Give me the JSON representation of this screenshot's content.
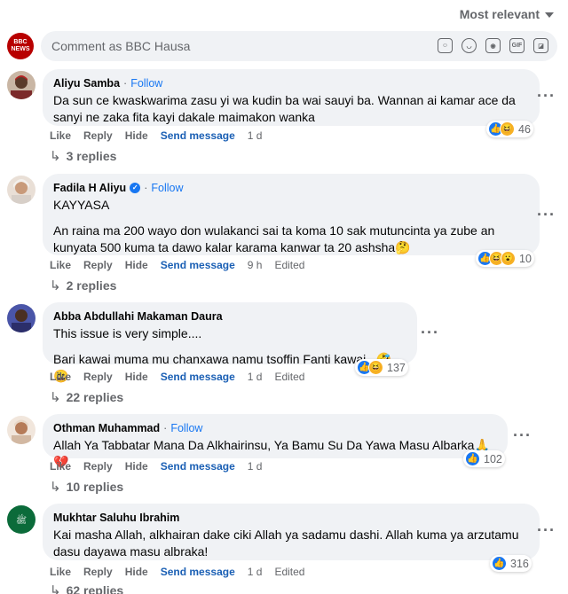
{
  "sort": {
    "label": "Most relevant"
  },
  "composer": {
    "placeholder": "Comment as BBC Hausa",
    "avatar_text_1": "BBC",
    "avatar_text_2": "NEWS"
  },
  "comments": [
    {
      "name": "Aliyu Samba",
      "follow": "Follow",
      "lines": [
        "Da sun ce kwaskwarima zasu yi wa kudin ba wai sauyi ba. Wannan ai kamar ace da sanyi ne zaka fita kayi dakale maimakon wanka"
      ],
      "actions": {
        "like": "Like",
        "reply": "Reply",
        "hide": "Hide",
        "send": "Send message",
        "time": "1 d",
        "edited": ""
      },
      "reactions": {
        "count": "46",
        "types": [
          "like",
          "haha"
        ]
      },
      "replies": "3 replies"
    },
    {
      "name": "Fadila H Aliyu",
      "follow": "Follow",
      "lines": [
        "KAYYASA",
        "An raina ma 200 wayo don wulakanci sai ta koma 10 sak mutuncinta ya zube an kunyata 500 kuma ta dawo kalar karama kanwar ta 20 ashsha🤔"
      ],
      "actions": {
        "like": "Like",
        "reply": "Reply",
        "hide": "Hide",
        "send": "Send message",
        "time": "9 h",
        "edited": "Edited"
      },
      "reactions": {
        "count": "10",
        "types": [
          "like",
          "haha",
          "wow"
        ]
      },
      "replies": "2 replies"
    },
    {
      "name": "Abba Abdullahi Makaman Daura",
      "follow": "",
      "lines": [
        "This issue is very simple....",
        "Bari kawai muma mu chanxawa namu tsoffin Fanti kawai...🤣😄"
      ],
      "actions": {
        "like": "Like",
        "reply": "Reply",
        "hide": "Hide",
        "send": "Send message",
        "time": "1 d",
        "edited": "Edited"
      },
      "reactions": {
        "count": "137",
        "types": [
          "like",
          "haha"
        ]
      },
      "replies": "22 replies"
    },
    {
      "name": "Othman Muhammad",
      "follow": "Follow",
      "lines": [
        "Allah Ya Tabbatar Mana Da Alkhairinsu, Ya Bamu Su Da Yawa Masu Albarka🙏💔"
      ],
      "actions": {
        "like": "Like",
        "reply": "Reply",
        "hide": "Hide",
        "send": "Send message",
        "time": "1 d",
        "edited": ""
      },
      "reactions": {
        "count": "102",
        "types": [
          "like"
        ]
      },
      "replies": "10 replies"
    },
    {
      "name": "Mukhtar Saluhu Ibrahim",
      "follow": "",
      "lines": [
        "Kai masha Allah, alkhairan dake ciki Allah ya sadamu dashi. Allah kuma ya arzutamu dasu dayawa masu albraka!"
      ],
      "actions": {
        "like": "Like",
        "reply": "Reply",
        "hide": "Hide",
        "send": "Send message",
        "time": "1 d",
        "edited": "Edited"
      },
      "reactions": {
        "count": "316",
        "types": [
          "like"
        ]
      },
      "replies": "62 replies"
    }
  ]
}
